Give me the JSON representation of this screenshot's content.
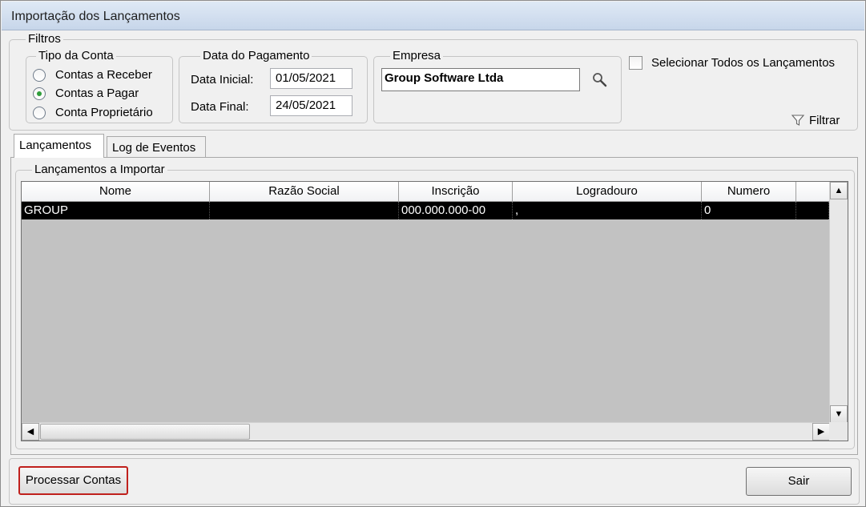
{
  "window": {
    "title": "Importação dos Lançamentos"
  },
  "filters": {
    "label": "Filtros",
    "account_type": {
      "label": "Tipo da Conta",
      "options": [
        {
          "label": "Contas a Receber",
          "checked": false
        },
        {
          "label": "Contas a Pagar",
          "checked": true
        },
        {
          "label": "Conta Proprietário",
          "checked": false
        }
      ]
    },
    "payment_date": {
      "label": "Data do Pagamento",
      "start_label": "Data Inicial:",
      "start_value": "01/05/2021",
      "end_label": "Data Final:",
      "end_value": "24/05/2021"
    },
    "company": {
      "label": "Empresa",
      "value": "Group Software Ltda",
      "search_icon": "search-icon"
    },
    "select_all_label": "Selecionar Todos os Lançamentos",
    "select_all_checked": false,
    "filter_button_label": "Filtrar",
    "filter_icon": "funnel-icon"
  },
  "tabs": [
    {
      "label": "Lançamentos",
      "active": true
    },
    {
      "label": "Log de Eventos",
      "active": false
    }
  ],
  "entries": {
    "label": "Lançamentos a Importar",
    "columns": [
      "Nome",
      "Razão Social",
      "Inscrição",
      "Logradouro",
      "Numero"
    ],
    "rows": [
      {
        "nome": "GROUP",
        "razao_social": "",
        "inscricao": "000.000.000-00",
        "logradouro": ",",
        "numero": "0"
      }
    ]
  },
  "actions": {
    "process_label": "Processar Contas",
    "exit_label": "Sair"
  },
  "colors": {
    "selection_row": "#000000",
    "grid_empty": "#c2c2c2",
    "radio_checked": "#2f9d3b",
    "focus_border": "#c0201c"
  }
}
